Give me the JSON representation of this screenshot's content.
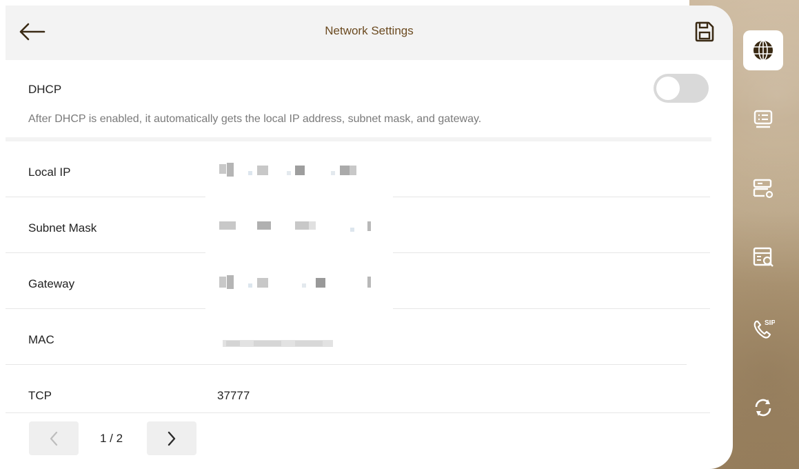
{
  "header": {
    "title": "Network Settings"
  },
  "dhcp": {
    "label": "DHCP",
    "description": "After DHCP is enabled, it automatically gets the local IP address, subnet mask, and gateway.",
    "enabled": false
  },
  "rows": [
    {
      "label": "Local IP",
      "value": ""
    },
    {
      "label": "Subnet Mask",
      "value": ""
    },
    {
      "label": "Gateway",
      "value": ""
    },
    {
      "label": "MAC",
      "value": ""
    },
    {
      "label": "TCP",
      "value": "37777"
    }
  ],
  "pager": {
    "page": "1 / 2"
  },
  "sidebar": {
    "items": [
      {
        "icon": "globe-icon",
        "active": true
      },
      {
        "icon": "list-icon",
        "active": false
      },
      {
        "icon": "server-settings-icon",
        "active": false
      },
      {
        "icon": "server-search-icon",
        "active": false
      },
      {
        "icon": "sip-phone-icon",
        "label": "SIP",
        "active": false
      },
      {
        "icon": "sync-icon",
        "active": false
      }
    ]
  },
  "colors": {
    "accent": "#6b4a20",
    "sidebar_bg": "#b8a07e"
  }
}
